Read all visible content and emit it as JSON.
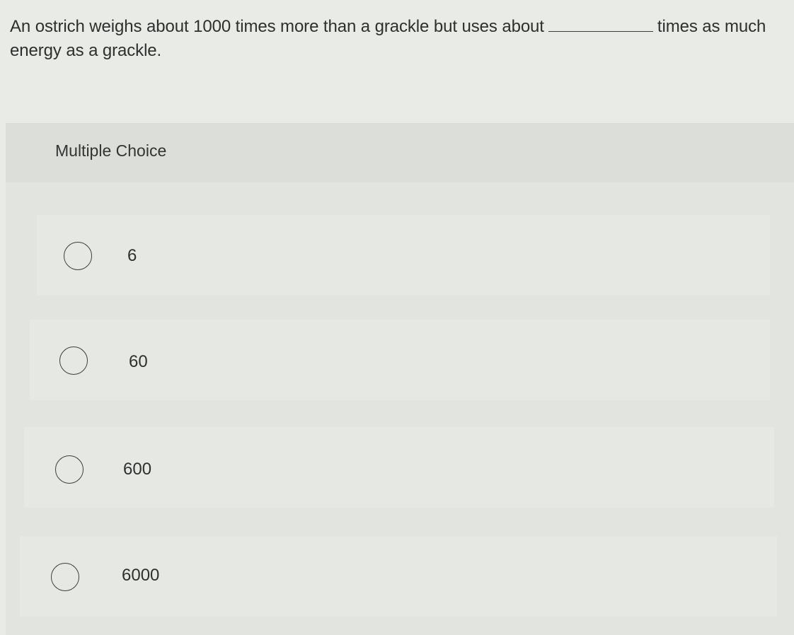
{
  "question": {
    "text_before": "An ostrich weighs about 1000 times more than a grackle but uses about",
    "text_after": "times as much energy as a grackle."
  },
  "multiple_choice": {
    "title": "Multiple Choice",
    "options": [
      {
        "label": "6",
        "selected": false
      },
      {
        "label": "60",
        "selected": false
      },
      {
        "label": "600",
        "selected": false
      },
      {
        "label": "6000",
        "selected": false
      }
    ]
  }
}
